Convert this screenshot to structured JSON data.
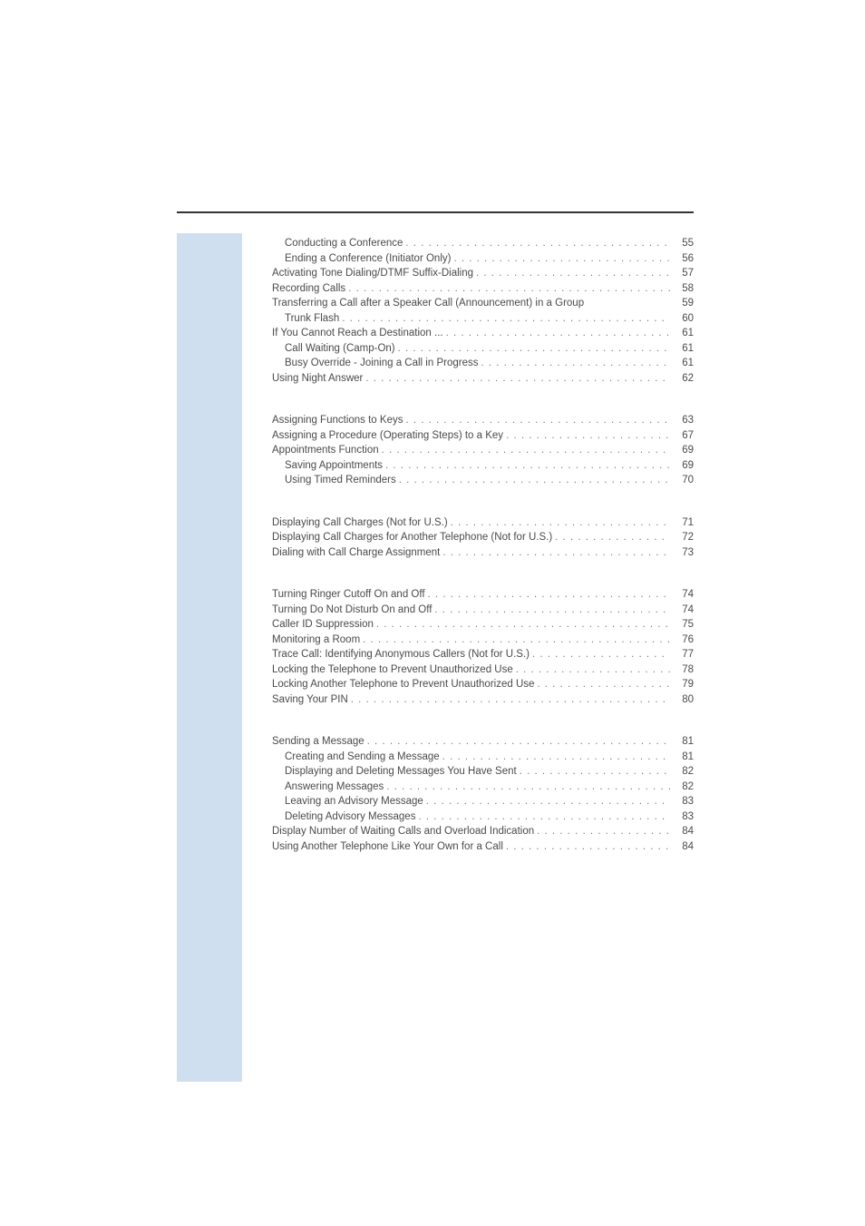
{
  "leader_dots": ". . . . . . . . . . . . . . . . . . . . . . . . . . . . . . . . . . . . . . . . . . . . . . . . . . . . . . . . . . . . . . . . . . . . . . . . . . . . . . . . . . . . . . . . . . . . . . . . . . . . . . . . . . . . . . . . . . . . . . . .",
  "sections": [
    {
      "entries": [
        {
          "label": "Conducting a Conference",
          "page": "55",
          "indent": 1,
          "leader": true
        },
        {
          "label": "Ending a Conference (Initiator Only)",
          "page": "56",
          "indent": 1,
          "leader": true
        },
        {
          "label": "Activating Tone Dialing/DTMF Suffix-Dialing",
          "page": "57",
          "indent": 0,
          "leader": true
        },
        {
          "label": "Recording Calls",
          "page": "58",
          "indent": 0,
          "leader": true
        },
        {
          "label": "Transferring a Call after a Speaker Call (Announcement) in a Group",
          "page": "59",
          "indent": 0,
          "leader": false
        },
        {
          "label": "Trunk Flash",
          "page": "60",
          "indent": 1,
          "leader": true
        },
        {
          "label": "If You Cannot Reach a Destination ...",
          "page": "61",
          "indent": 0,
          "leader": true
        },
        {
          "label": "Call Waiting (Camp-On)",
          "page": "61",
          "indent": 1,
          "leader": true
        },
        {
          "label": "Busy Override - Joining a Call in Progress",
          "page": "61",
          "indent": 1,
          "leader": true
        },
        {
          "label": "Using Night Answer",
          "page": "62",
          "indent": 0,
          "leader": true
        }
      ]
    },
    {
      "entries": [
        {
          "label": "Assigning Functions to Keys",
          "page": "63",
          "indent": 0,
          "leader": true
        },
        {
          "label": "Assigning a Procedure (Operating Steps) to a Key",
          "page": "67",
          "indent": 0,
          "leader": true
        },
        {
          "label": "Appointments Function",
          "page": "69",
          "indent": 0,
          "leader": true
        },
        {
          "label": "Saving Appointments",
          "page": "69",
          "indent": 1,
          "leader": true
        },
        {
          "label": "Using Timed Reminders",
          "page": "70",
          "indent": 1,
          "leader": true
        }
      ]
    },
    {
      "entries": [
        {
          "label": "Displaying Call Charges (Not for U.S.)",
          "page": "71",
          "indent": 0,
          "leader": true
        },
        {
          "label": "Displaying Call Charges for Another Telephone (Not for U.S.)",
          "page": "72",
          "indent": 0,
          "leader": true
        },
        {
          "label": "Dialing with Call Charge Assignment",
          "page": "73",
          "indent": 0,
          "leader": true
        }
      ]
    },
    {
      "entries": [
        {
          "label": "Turning Ringer Cutoff On and Off",
          "page": "74",
          "indent": 0,
          "leader": true
        },
        {
          "label": "Turning Do Not Disturb On and Off",
          "page": "74",
          "indent": 0,
          "leader": true
        },
        {
          "label": "Caller ID Suppression",
          "page": "75",
          "indent": 0,
          "leader": true
        },
        {
          "label": "Monitoring a Room",
          "page": "76",
          "indent": 0,
          "leader": true
        },
        {
          "label": "Trace Call: Identifying Anonymous Callers (Not for U.S.)",
          "page": "77",
          "indent": 0,
          "leader": true
        },
        {
          "label": "Locking the Telephone to Prevent Unauthorized Use",
          "page": "78",
          "indent": 0,
          "leader": true
        },
        {
          "label": "Locking Another Telephone to Prevent Unauthorized Use",
          "page": "79",
          "indent": 0,
          "leader": true
        },
        {
          "label": "Saving Your PIN",
          "page": "80",
          "indent": 0,
          "leader": true
        }
      ]
    },
    {
      "entries": [
        {
          "label": "Sending a Message",
          "page": "81",
          "indent": 0,
          "leader": true
        },
        {
          "label": "Creating and Sending a Message",
          "page": "81",
          "indent": 1,
          "leader": true
        },
        {
          "label": "Displaying and Deleting Messages You Have Sent",
          "page": "82",
          "indent": 1,
          "leader": true
        },
        {
          "label": "Answering Messages",
          "page": "82",
          "indent": 1,
          "leader": true
        },
        {
          "label": "Leaving an Advisory Message",
          "page": "83",
          "indent": 1,
          "leader": true
        },
        {
          "label": "Deleting Advisory Messages",
          "page": "83",
          "indent": 1,
          "leader": true
        },
        {
          "label": "Display Number of Waiting Calls and Overload Indication",
          "page": "84",
          "indent": 0,
          "leader": true
        },
        {
          "label": "Using Another Telephone Like Your Own for a Call",
          "page": "84",
          "indent": 0,
          "leader": true
        }
      ]
    }
  ]
}
